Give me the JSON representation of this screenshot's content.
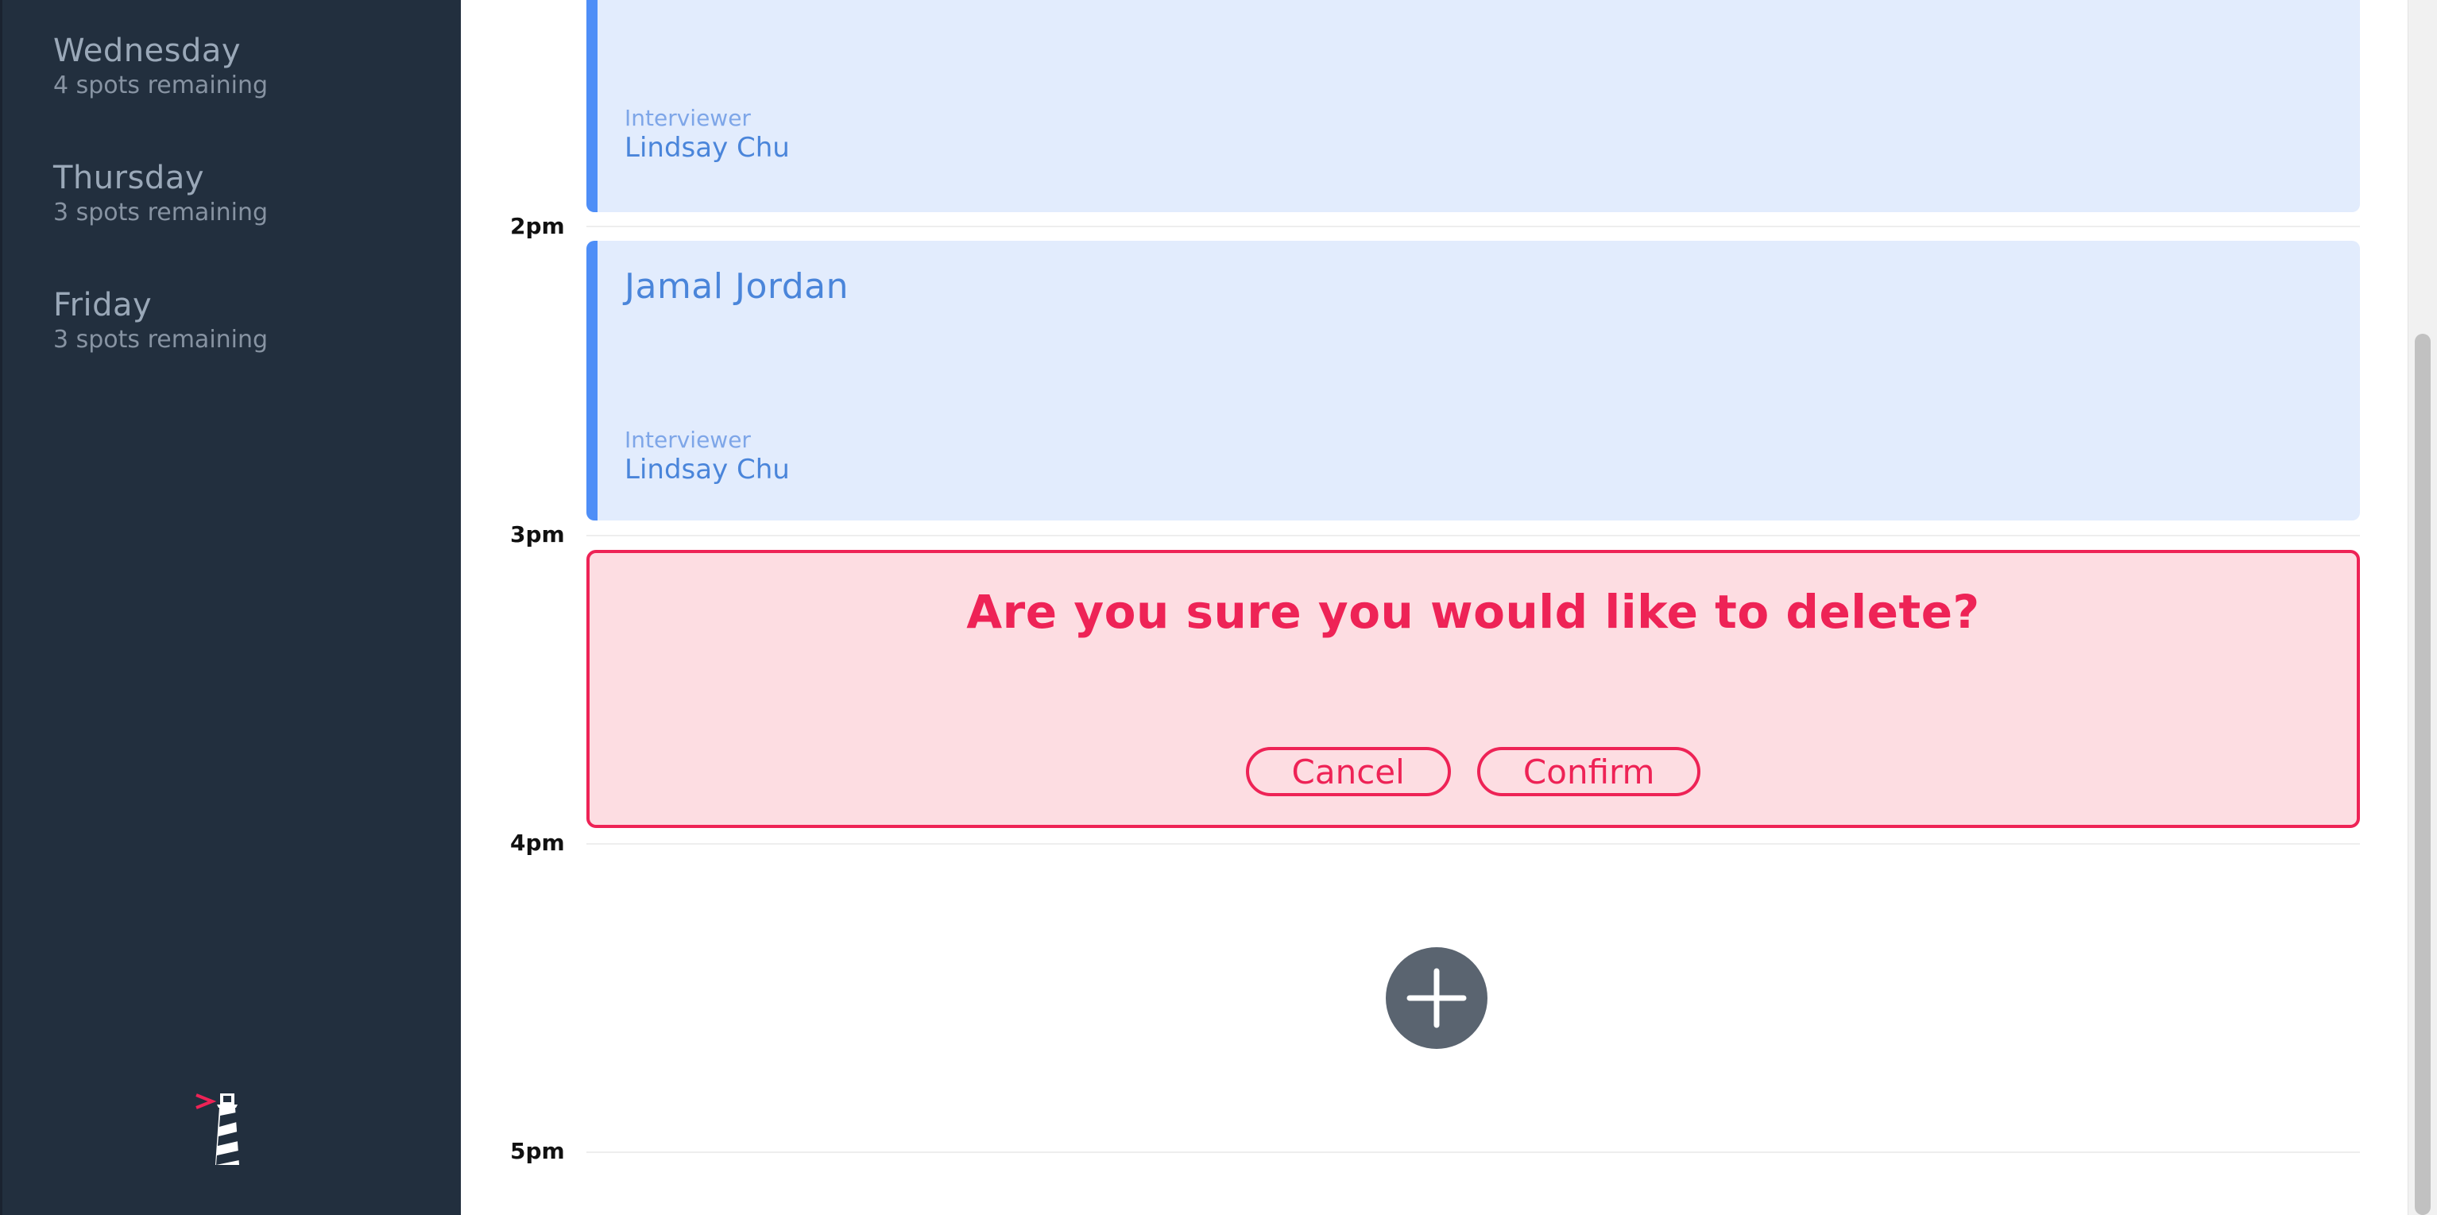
{
  "sidebar": {
    "days": [
      {
        "name": "Wednesday",
        "spots": "4 spots remaining"
      },
      {
        "name": "Thursday",
        "spots": "3 spots remaining"
      },
      {
        "name": "Friday",
        "spots": "3 spots remaining"
      }
    ],
    "logo_icon": "lighthouse-logo-icon"
  },
  "schedule": {
    "times": [
      "2pm",
      "3pm",
      "4pm",
      "5pm"
    ],
    "appointments": [
      {
        "student": "",
        "interviewer_caption": "Interviewer",
        "interviewer": "Lindsay Chu"
      },
      {
        "student": "Jamal Jordan",
        "interviewer_caption": "Interviewer",
        "interviewer": "Lindsay Chu"
      }
    ],
    "confirm": {
      "message": "Are you sure you would like to delete?",
      "cancel_label": "Cancel",
      "confirm_label": "Confirm"
    },
    "add_icon": "plus-icon"
  },
  "colors": {
    "sidebar_bg": "#222f3e",
    "appointment_bg": "#e2ecfd",
    "appointment_accent": "#4e8ef7",
    "danger": "#ee2356",
    "danger_bg": "#fddde2",
    "add_button": "#5a6470"
  }
}
